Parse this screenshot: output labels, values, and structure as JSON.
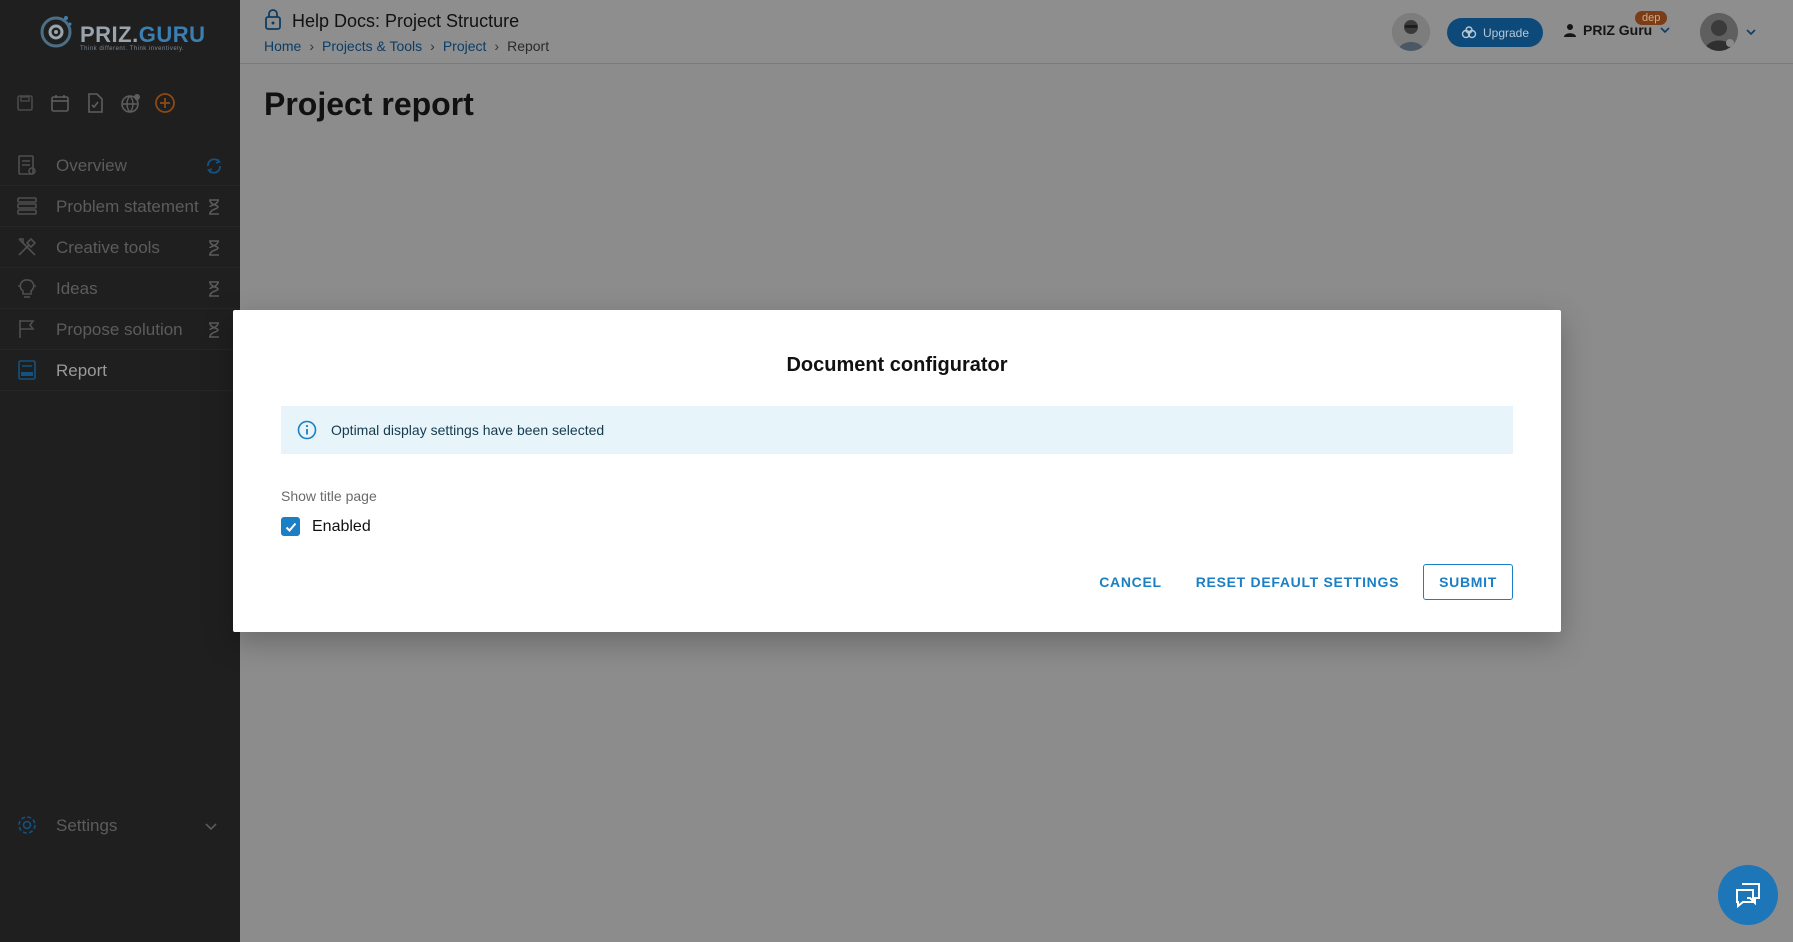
{
  "sidebar": {
    "logo": {
      "name_part1": "PRIZ.",
      "name_part2": "GURU",
      "tagline": "Think different. Think inventively."
    },
    "quick_icons": [
      "save-icon",
      "calendar-icon",
      "document-icon",
      "globe-icon",
      "add-circle-icon"
    ],
    "items": [
      {
        "label": "Overview",
        "icon": "overview-icon",
        "status": "sync-icon"
      },
      {
        "label": "Problem statement",
        "icon": "list-icon",
        "status": "hourglass-icon"
      },
      {
        "label": "Creative tools",
        "icon": "tools-icon",
        "status": "hourglass-icon"
      },
      {
        "label": "Ideas",
        "icon": "lightbulb-icon",
        "status": "hourglass-icon"
      },
      {
        "label": "Propose solution",
        "icon": "flag-icon",
        "status": "hourglass-icon"
      },
      {
        "label": "Report",
        "icon": "report-icon",
        "status": ""
      }
    ],
    "settings_label": "Settings"
  },
  "header": {
    "title": "Help Docs: Project Structure",
    "breadcrumb": [
      "Home",
      "Projects & Tools",
      "Project",
      "Report"
    ],
    "upgrade_label": "Upgrade",
    "user_name": "PRIZ Guru",
    "badge": "dep"
  },
  "page_title": "Project report",
  "modal": {
    "title": "Document configurator",
    "alert_text": "Optimal display settings have been selected",
    "field_label": "Show title page",
    "checkbox_label": "Enabled",
    "checkbox_checked": true,
    "cancel_label": "CANCEL",
    "reset_label": "RESET DEFAULT SETTINGS",
    "submit_label": "SUBMIT"
  },
  "colors": {
    "accent": "#1a7fc4",
    "sidebar_bg": "#1f1f1f",
    "overlay_bg": "#8c8c8c",
    "alert_bg": "#e7f5fb",
    "badge_bg": "#7a3d17"
  }
}
